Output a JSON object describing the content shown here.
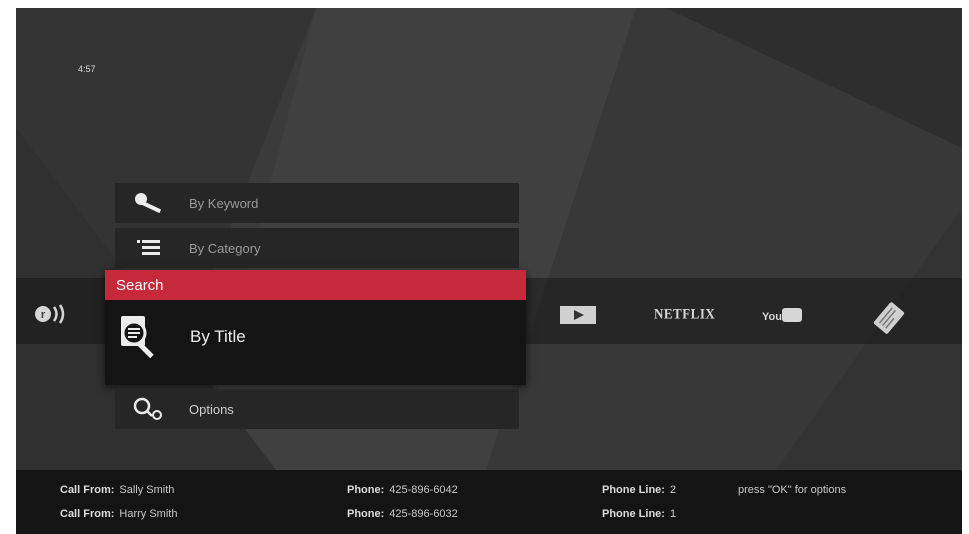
{
  "clock": "4:57",
  "menu": {
    "keyword_label": "By Keyword",
    "category_label": "By Category",
    "search_header": "Search",
    "title_label": "By Title",
    "options_label": "Options"
  },
  "apps": {
    "netflix_label": "NETFLIX",
    "youtube_label": "You"
  },
  "calls": {
    "call_from_label": "Call From:",
    "phone_label": "Phone:",
    "phone_line_label": "Phone Line:",
    "rows": [
      {
        "name": "Sally Smith",
        "phone": "425-896-6042",
        "line": "2"
      },
      {
        "name": "Harry Smith",
        "phone": "425-896-6032",
        "line": "1"
      }
    ],
    "hint": "press \"OK\" for options"
  },
  "colors": {
    "accent": "#c6293a",
    "background": "#3b3b3b",
    "bar": "#141414"
  },
  "icons": {
    "keyword": "key-icon",
    "category": "list-icon",
    "title": "magnify-document-icon",
    "options": "search-options-icon",
    "sound": "sound-waves-icon",
    "play": "play-icon",
    "card": "card-icon"
  }
}
